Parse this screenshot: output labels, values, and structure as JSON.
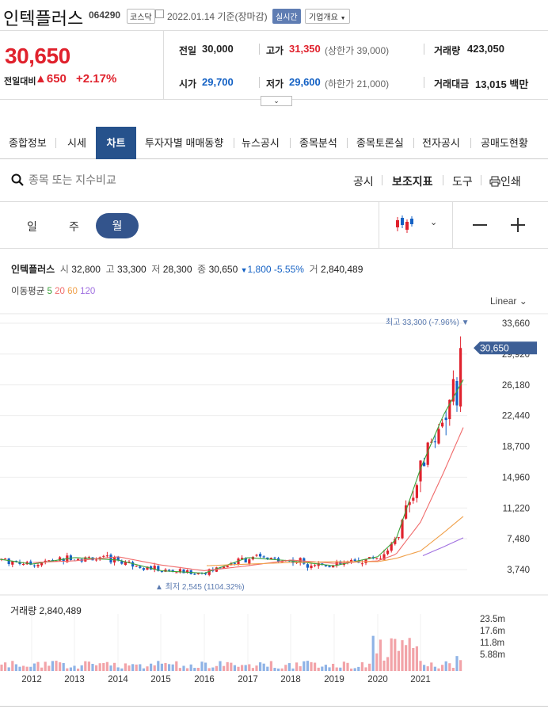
{
  "header": {
    "name": "인텍플러스",
    "code": "064290",
    "market": "코스닥",
    "date": "2022.01.14",
    "date_suffix": "기준(장마감)",
    "realtime": "실시간",
    "company_menu": "기업개요"
  },
  "price": {
    "current": "30,650",
    "change_label": "전일대비",
    "change_value": "650",
    "change_pct": "+2.17%"
  },
  "stats": {
    "prev_label": "전일",
    "prev": "30,000",
    "high_label": "고가",
    "high": "31,350",
    "upper_limit": "(상한가 39,000)",
    "volume_label": "거래량",
    "volume": "423,050",
    "open_label": "시가",
    "open": "29,700",
    "low_label": "저가",
    "low": "29,600",
    "lower_limit": "(하한가 21,000)",
    "amount_label": "거래대금",
    "amount": "13,015",
    "amount_unit": "백만"
  },
  "tabs": [
    "종합정보",
    "시세",
    "차트",
    "투자자별 매매동향",
    "뉴스공시",
    "종목분석",
    "종목토론실",
    "전자공시",
    "공매도현황"
  ],
  "active_tab": "차트",
  "search": {
    "placeholder": "종목 또는 지수비교"
  },
  "tools": {
    "notice": "공시",
    "indicator": "보조지표",
    "tool": "도구",
    "print": "인쇄"
  },
  "periods": {
    "day": "일",
    "week": "주",
    "month": "월"
  },
  "active_period": "월",
  "ohlc": {
    "name": "인텍플러스",
    "open_label": "시",
    "open": "32,800",
    "high_label": "고",
    "high": "33,300",
    "low_label": "저",
    "low": "28,300",
    "close_label": "종",
    "close": "30,650",
    "change": "1,800",
    "change_pct": "-5.55%",
    "volume_label": "거",
    "volume": "2,840,489"
  },
  "ma": {
    "label": "이동평균",
    "p5": "5",
    "p20": "20",
    "p60": "60",
    "p120": "120"
  },
  "scale_mode": "Linear",
  "annotations": {
    "max": "최고 33,300 (-7.96%)",
    "min": "최저 2,545 (1104.32%)",
    "current_tag": "30,650"
  },
  "volume_panel": {
    "label": "거래량",
    "value": "2,840,489"
  },
  "colors": {
    "up": "#e0222d",
    "down": "#1461c4",
    "accent": "#26528c"
  },
  "chart_data": {
    "type": "line",
    "title": "인텍플러스",
    "scale": "linear",
    "yticks": [
      "33,660",
      "29,920",
      "26,180",
      "22,440",
      "18,700",
      "14,960",
      "11,220",
      "7,480",
      "3,740"
    ],
    "ylim": [
      2545,
      33660
    ],
    "volume_ticks": [
      "23.5m",
      "17.6m",
      "11.8m",
      "5.88m"
    ],
    "x_ticks": [
      "2012",
      "2013",
      "2014",
      "2015",
      "2016",
      "2017",
      "2018",
      "2019",
      "2020",
      "2021"
    ],
    "x": [
      "2011",
      "2012",
      "2013",
      "2014",
      "2015",
      "2016",
      "2017",
      "2018",
      "2019",
      "2020-01",
      "2020-07",
      "2021-01",
      "2021-07",
      "2022-01"
    ],
    "series": [
      {
        "name": "5",
        "color": "#3aa23a",
        "values": [
          5000,
          4400,
          5200,
          4900,
          3600,
          3300,
          5200,
          4800,
          4200,
          5300,
          7400,
          16000,
          22500,
          26800
        ]
      },
      {
        "name": "20",
        "color": "#f06a6a",
        "values": [
          null,
          4600,
          4800,
          5300,
          4300,
          3600,
          4200,
          4900,
          4500,
          4800,
          5600,
          9500,
          15500,
          21000
        ]
      },
      {
        "name": "60",
        "color": "#f0a04a",
        "values": [
          null,
          null,
          null,
          null,
          null,
          4200,
          4400,
          4600,
          4700,
          4700,
          5100,
          6000,
          8200,
          10200
        ]
      },
      {
        "name": "120",
        "color": "#a070e0",
        "values": [
          null,
          null,
          null,
          null,
          null,
          null,
          null,
          null,
          null,
          null,
          null,
          5300,
          6500,
          7600
        ]
      }
    ],
    "max_value": 33300,
    "min_value": 2545,
    "last_close": 30650
  }
}
